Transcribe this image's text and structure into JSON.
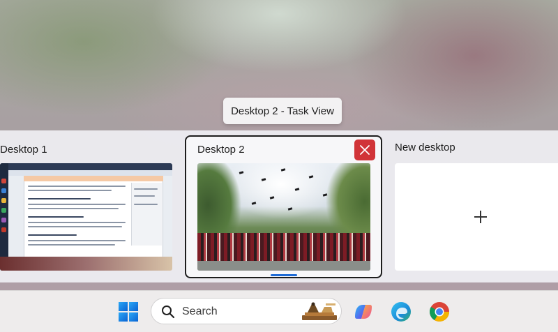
{
  "tooltip": {
    "text": "Desktop 2 - Task View"
  },
  "desktops": [
    {
      "label": "Desktop 1"
    },
    {
      "label": "Desktop 2",
      "active": true
    },
    {
      "label": "New desktop"
    }
  ],
  "taskbar": {
    "search_placeholder": "Search",
    "apps": [
      {
        "icon": "windows-start-icon"
      },
      {
        "icon": "copilot-icon"
      },
      {
        "icon": "edge-icon"
      },
      {
        "icon": "chrome-icon"
      }
    ]
  },
  "colors": {
    "accent": "#1e6bd6",
    "close": "#d13438"
  }
}
